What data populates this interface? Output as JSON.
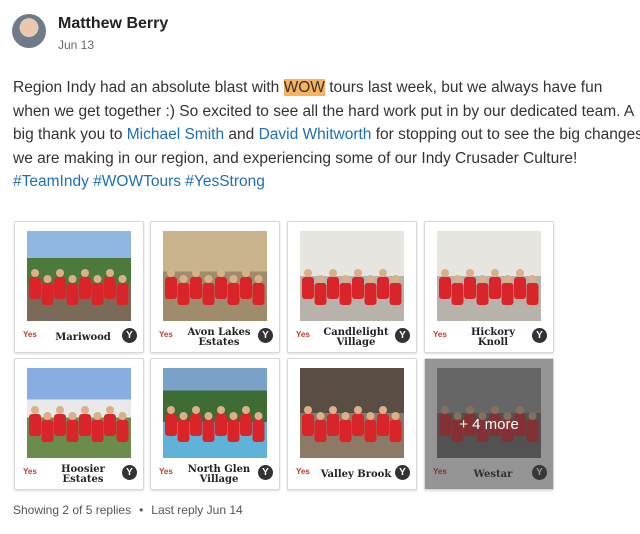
{
  "post": {
    "author": "Matthew Berry",
    "date": "Jun 13",
    "text_before_hl": "Region Indy had an absolute blast with ",
    "highlight": "WOW",
    "text_after_hl": " tours last week, but we always have fun when we get together :)  So excited to see all the hard work put in by our dedicated team. A big thank you to ",
    "mention1": "Michael Smith",
    "and_text": " and ",
    "mention2": "David Whitworth",
    "text_mid": " for stopping out to see the big changes we are making in our region, and experiencing some of our Indy Crusader Culture!  ",
    "hashtag1": "#TeamIndy",
    "hashtag2": "#WOWTours",
    "hashtag3": "#YesStrong"
  },
  "gallery": {
    "photos": [
      {
        "caption": "Mariwood",
        "scene": "sign"
      },
      {
        "caption": "Avon Lakes Estates",
        "scene": "indoor"
      },
      {
        "caption": "Candlelight Village",
        "scene": "indoor-light"
      },
      {
        "caption": "Hickory Knoll",
        "scene": "indoor-light"
      },
      {
        "caption": "Hoosier Estates",
        "scene": "outdoor"
      },
      {
        "caption": "North Glen Village",
        "scene": "pool"
      },
      {
        "caption": "Valley Brook",
        "scene": "indoor-dark"
      },
      {
        "caption": "Westar",
        "scene": "outdoor-gray"
      }
    ],
    "more_label": "+ 4 more",
    "logo_text": "Yes"
  },
  "footer": {
    "replies": "Showing 2 of 5 replies",
    "separator": "•",
    "last_reply": "Last reply Jun 14"
  },
  "colors": {
    "link": "#1d6fb8",
    "highlight": "#f8b25c",
    "shirt": "#d9252a"
  }
}
